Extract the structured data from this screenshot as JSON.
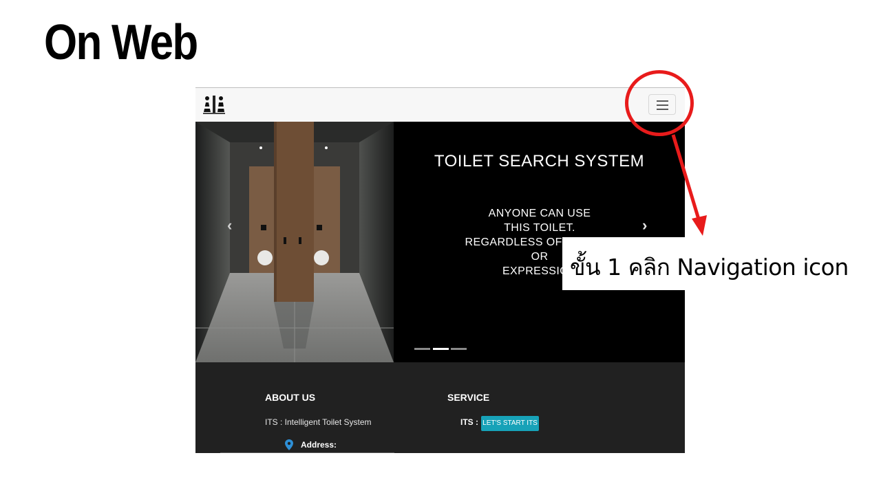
{
  "slide": {
    "title": "On Web",
    "annotation": "ขั้น 1 คลิก Navigation icon",
    "highlight_color": "#e81b1b"
  },
  "navbar": {
    "logo_icon": "restroom-logo-icon",
    "toggler_icon": "hamburger-menu-icon"
  },
  "hero": {
    "title": "TOILET SEARCH SYSTEM",
    "subtitle_lines": [
      "ANYONE CAN USE",
      "THIS TOILET.",
      "REGARDLESS OF GENDER",
      "OR",
      "EXPRESSION"
    ],
    "indicators": [
      false,
      true,
      false
    ]
  },
  "footer": {
    "about_heading": "ABOUT US",
    "about_text": "ITS : Intelligent Toilet System",
    "address_label": "Address:",
    "service_heading": "SERVICE",
    "its_label": "ITS :",
    "start_button": "LET'S START ITS",
    "accent": "#17a2b8"
  }
}
